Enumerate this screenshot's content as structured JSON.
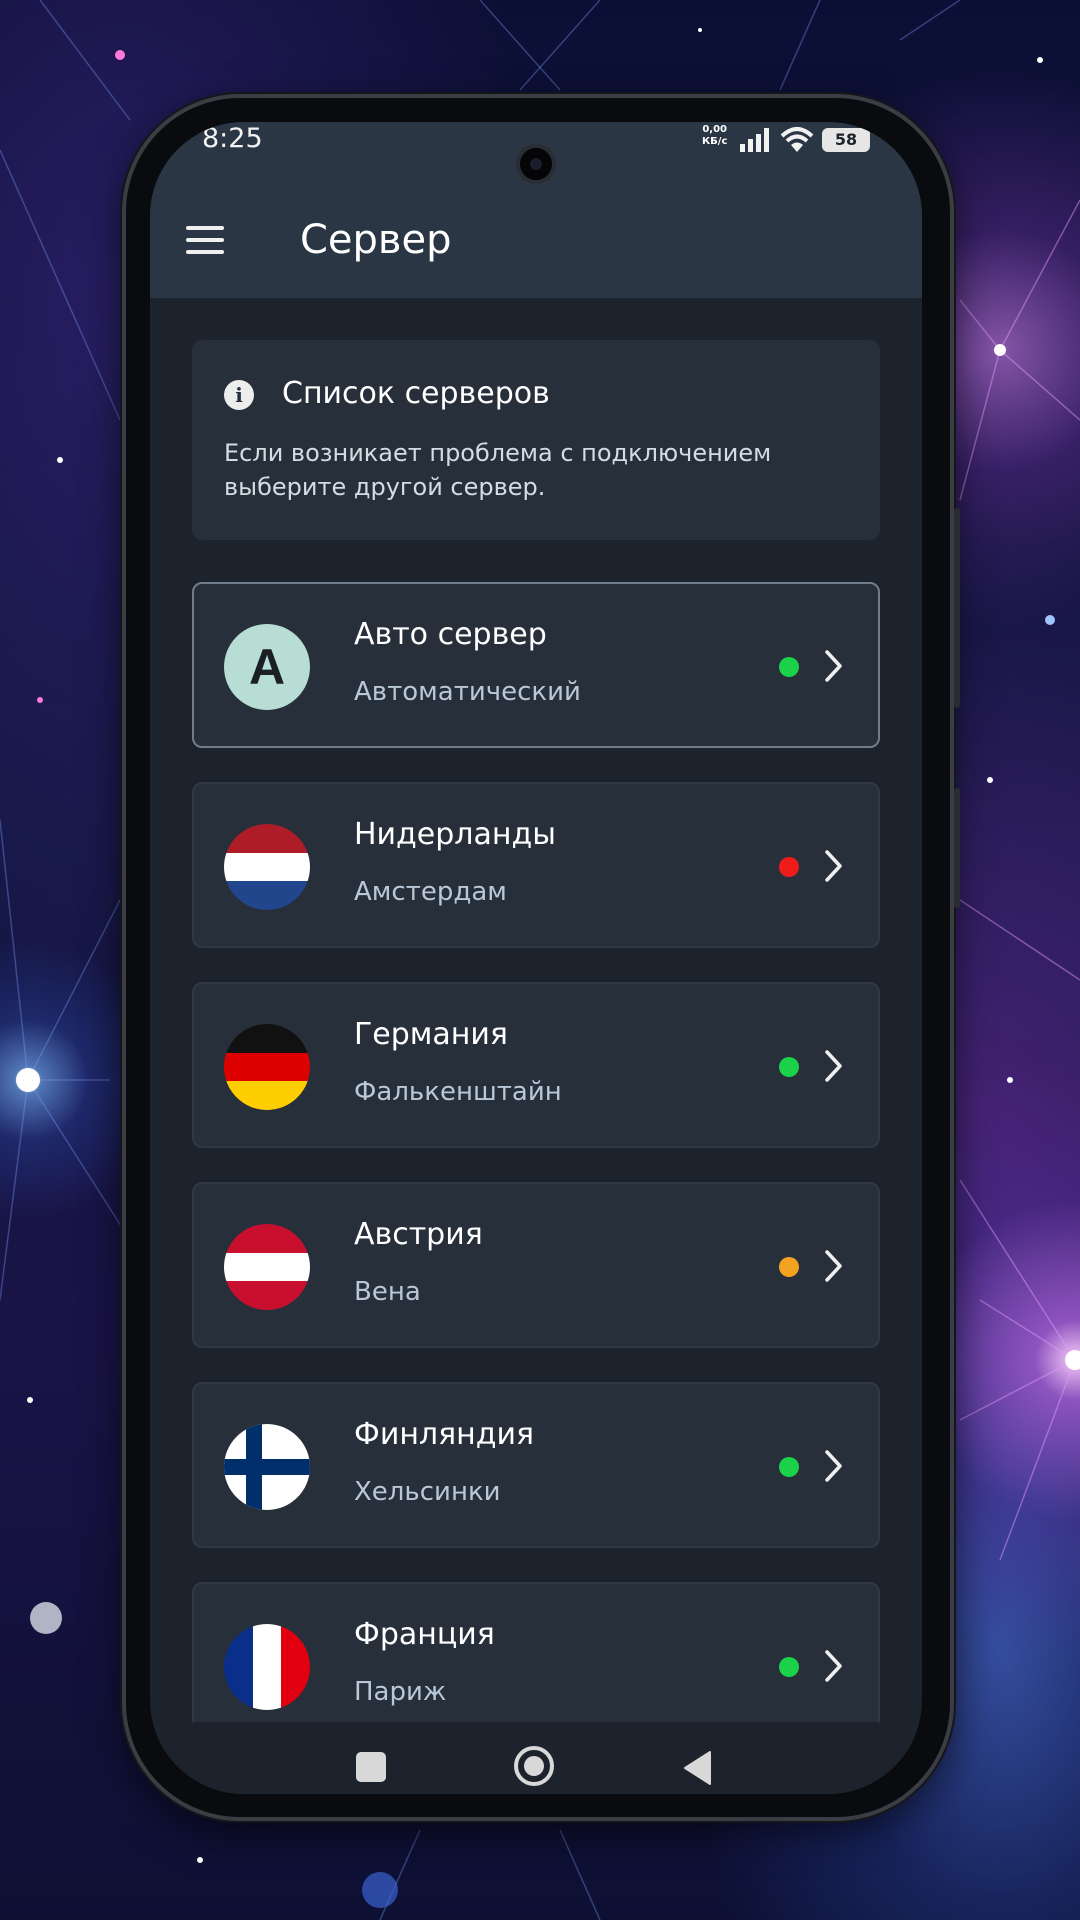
{
  "status_bar": {
    "time": "8:25",
    "speed_value": "0,00",
    "speed_unit": "КБ/с",
    "battery": "58",
    "icons": [
      "signal-icon",
      "wifi-icon",
      "battery-icon"
    ]
  },
  "header": {
    "title": "Сервер",
    "menu_icon": "hamburger-menu-icon"
  },
  "info": {
    "icon": "info-icon",
    "title": "Список серверов",
    "text": "Если возникает проблема с подключением выберите другой сервер."
  },
  "servers": [
    {
      "name": "Авто сервер",
      "city": "Автоматический",
      "badge": "A",
      "status": "green",
      "selected": true
    },
    {
      "name": "Нидерланды",
      "city": "Амстердам",
      "flag": "nl-flag-icon",
      "status": "red"
    },
    {
      "name": "Германия",
      "city": "Фалькенштайн",
      "flag": "de-flag-icon",
      "status": "green"
    },
    {
      "name": "Австрия",
      "city": "Вена",
      "flag": "at-flag-icon",
      "status": "orange"
    },
    {
      "name": "Финляндия",
      "city": "Хельсинки",
      "flag": "fi-flag-icon",
      "status": "green"
    },
    {
      "name": "Франция",
      "city": "Париж",
      "flag": "fr-flag-icon",
      "status": "green"
    }
  ],
  "status_colors": {
    "green": "#1bd14a",
    "red": "#f01b1b",
    "orange": "#f4a321"
  },
  "nav": {
    "icons": [
      "recent-apps-icon",
      "home-icon",
      "back-icon"
    ]
  },
  "colors": {
    "header_bg": "#2a3643",
    "screen_bg": "#1c232c",
    "card_bg": "#262f3a",
    "accent_badge": "#b8ddd5"
  }
}
